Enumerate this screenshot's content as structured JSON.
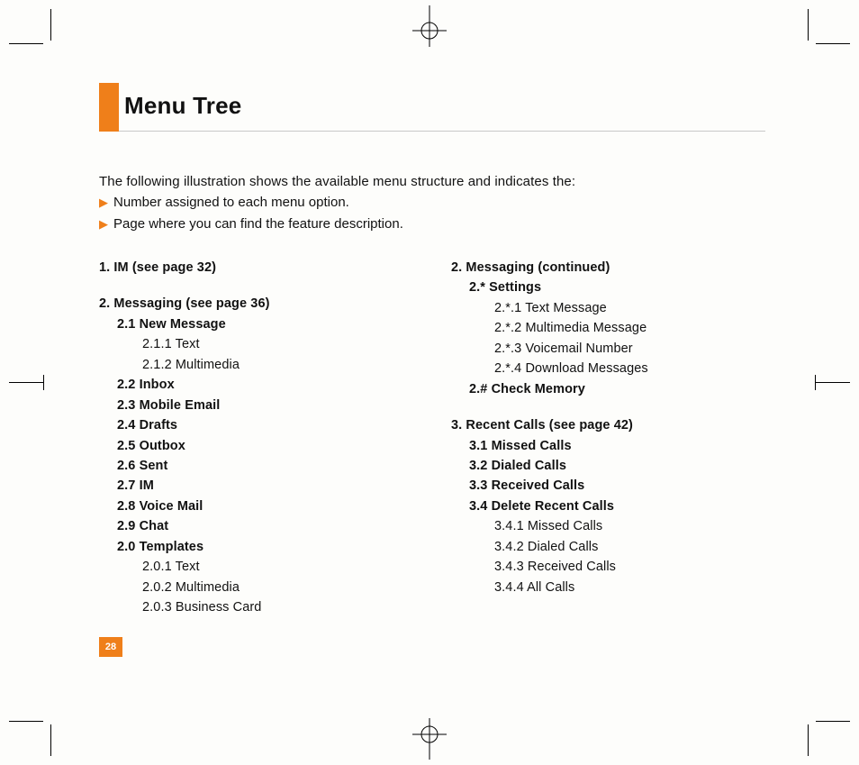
{
  "title": "Menu Tree",
  "intro": "The following illustration shows the available menu structure and indicates the:",
  "bullets": [
    "Number assigned to each menu option.",
    "Page where you can find the feature description."
  ],
  "left_column": {
    "sections": [
      {
        "type": "lvl1",
        "text": "1.  IM (see page 32)"
      },
      {
        "type": "spacer"
      },
      {
        "type": "lvl1",
        "text": "2.  Messaging (see page 36)"
      },
      {
        "type": "lvl2",
        "text": "2.1 New Message"
      },
      {
        "type": "lvl3",
        "text": "2.1.1 Text"
      },
      {
        "type": "lvl3",
        "text": "2.1.2 Multimedia"
      },
      {
        "type": "lvl2",
        "text": "2.2 Inbox"
      },
      {
        "type": "lvl2",
        "text": "2.3 Mobile Email"
      },
      {
        "type": "lvl2",
        "text": "2.4 Drafts"
      },
      {
        "type": "lvl2",
        "text": "2.5 Outbox"
      },
      {
        "type": "lvl2",
        "text": "2.6 Sent"
      },
      {
        "type": "lvl2",
        "text": "2.7 IM"
      },
      {
        "type": "lvl2",
        "text": "2.8 Voice Mail"
      },
      {
        "type": "lvl2",
        "text": "2.9 Chat"
      },
      {
        "type": "lvl2",
        "text": "2.0 Templates"
      },
      {
        "type": "lvl3",
        "text": "2.0.1 Text"
      },
      {
        "type": "lvl3",
        "text": "2.0.2 Multimedia"
      },
      {
        "type": "lvl3",
        "text": "2.0.3 Business Card"
      }
    ]
  },
  "right_column": {
    "sections": [
      {
        "type": "lvl1",
        "text": "2.  Messaging (continued)"
      },
      {
        "type": "lvl2",
        "text": "2.* Settings"
      },
      {
        "type": "lvl3",
        "text": "2.*.1 Text Message"
      },
      {
        "type": "lvl3",
        "text": "2.*.2 Multimedia Message"
      },
      {
        "type": "lvl3",
        "text": "2.*.3 Voicemail Number"
      },
      {
        "type": "lvl3",
        "text": "2.*.4 Download Messages"
      },
      {
        "type": "lvl2",
        "text": "2.# Check Memory"
      },
      {
        "type": "spacer"
      },
      {
        "type": "lvl1",
        "text": "3.  Recent Calls (see page 42)"
      },
      {
        "type": "lvl2",
        "text": "3.1 Missed Calls"
      },
      {
        "type": "lvl2",
        "text": "3.2 Dialed Calls"
      },
      {
        "type": "lvl2",
        "text": "3.3 Received Calls"
      },
      {
        "type": "lvl2",
        "text": "3.4 Delete Recent Calls"
      },
      {
        "type": "lvl3",
        "text": "3.4.1 Missed Calls"
      },
      {
        "type": "lvl3",
        "text": "3.4.2 Dialed Calls"
      },
      {
        "type": "lvl3",
        "text": "3.4.3 Received Calls"
      },
      {
        "type": "lvl3",
        "text": "3.4.4 All Calls"
      }
    ]
  },
  "page_number": "28",
  "arrow_glyph": "▶"
}
